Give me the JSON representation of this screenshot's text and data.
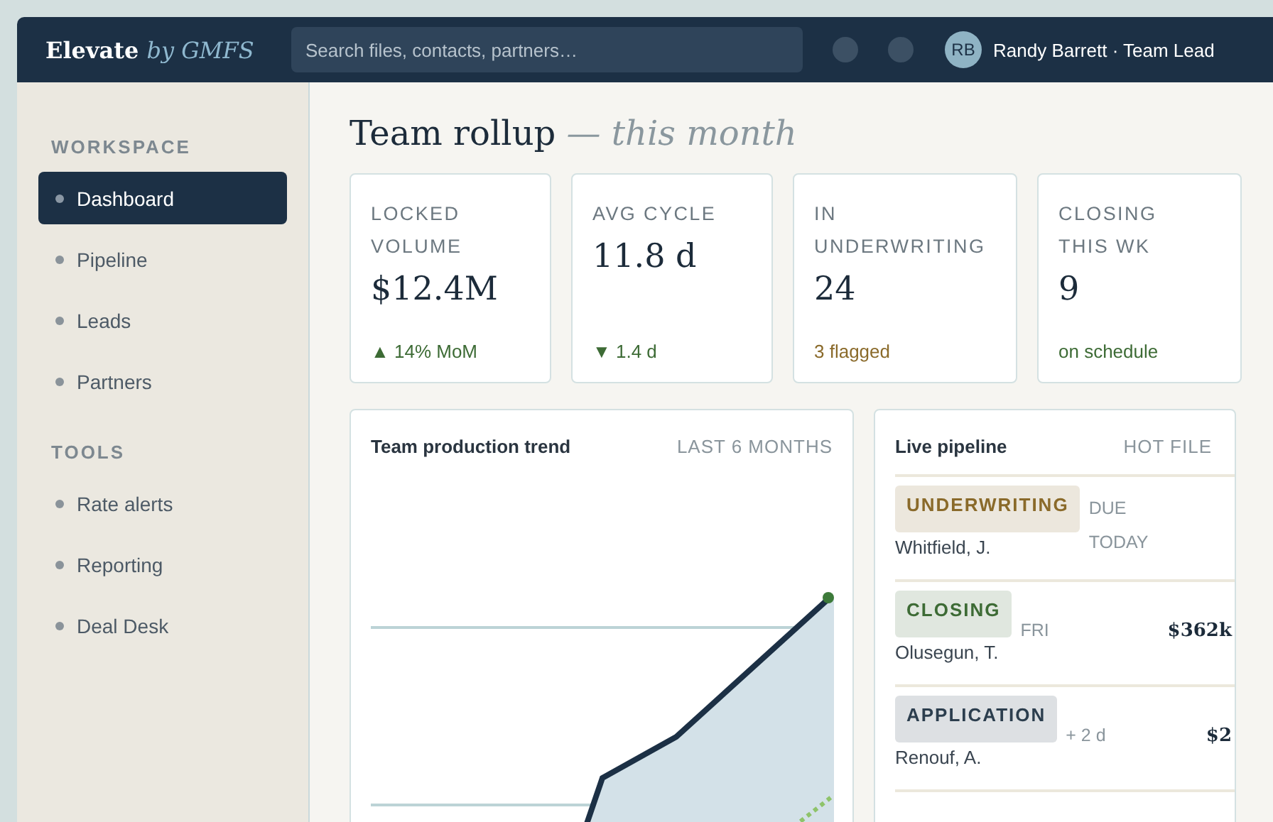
{
  "topbar": {
    "brand": "Elevate",
    "brand_suffix": "by GMFS",
    "search": {
      "placeholder": "Search files, contacts, partners…"
    },
    "user": {
      "initials": "RB",
      "name": "Randy Barrett · Team Lead"
    }
  },
  "sidebar": {
    "sections": [
      {
        "title": "WORKSPACE",
        "items": [
          {
            "label": "Dashboard",
            "selected": true
          },
          {
            "label": "Pipeline",
            "selected": false
          },
          {
            "label": "Leads",
            "selected": false
          },
          {
            "label": "Partners",
            "selected": false
          }
        ]
      },
      {
        "title": "TOOLS",
        "items": [
          {
            "label": "Rate alerts",
            "selected": false
          },
          {
            "label": "Reporting",
            "selected": false
          },
          {
            "label": "Deal Desk",
            "selected": false
          }
        ]
      }
    ]
  },
  "heading": {
    "title": "Team rollup",
    "subtitle": "— this month"
  },
  "stats": [
    {
      "label": "LOCKED VOLUME",
      "value": "$12.4M",
      "note": "▲ 14% MoM",
      "color": "#3d6b35"
    },
    {
      "label": "AVG CYCLE",
      "value": "11.8 d",
      "note": "▼ 1.4 d",
      "color": "#3d6b35"
    },
    {
      "label": "IN UNDERWRITING",
      "value": "24",
      "note": "3 flagged",
      "color": "#8a6a2a"
    },
    {
      "label": "CLOSING THIS WK",
      "value": "9",
      "note": "on schedule",
      "color": "#3d6b35"
    }
  ],
  "trend": {
    "title": "Team production trend",
    "range": "LAST 6 MONTHS"
  },
  "pipeline": {
    "title": "Live pipeline",
    "tag": "HOT FILE",
    "rows": [
      {
        "stage": "UNDERWRITING",
        "color": "#8a6a2a",
        "name": "Whitfield, J.",
        "due": "DUE TODAY"
      },
      {
        "stage": "CLOSING",
        "color": "#3d6b35",
        "name": "Olusegun, T.",
        "due": "FRI",
        "amount": "$362k"
      },
      {
        "stage": "APPLICATION",
        "color": "#2c3e4e",
        "name": "Renouf, A.",
        "due": "+ 2 d",
        "amount": "$2"
      }
    ]
  }
}
